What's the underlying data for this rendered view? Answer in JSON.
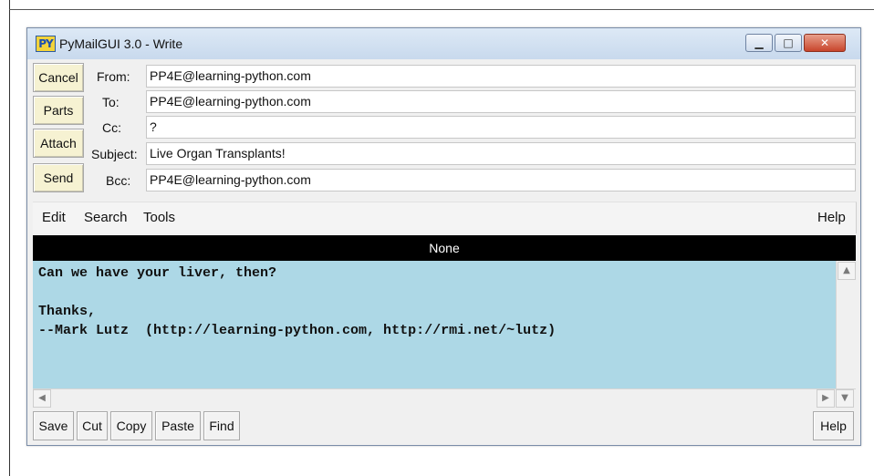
{
  "window": {
    "title": "PyMailGUI 3.0 - Write",
    "logo_text": "PY",
    "controls": {
      "minimize": "▁",
      "maximize": "□",
      "close": "✕"
    }
  },
  "side_buttons": [
    "Cancel",
    "Parts",
    "Attach",
    "Send"
  ],
  "headers": {
    "from": {
      "label": "From:",
      "value": "PP4E@learning-python.com"
    },
    "to": {
      "label": "To:",
      "value": "PP4E@learning-python.com"
    },
    "cc": {
      "label": "Cc:",
      "value": "?"
    },
    "subject": {
      "label": "Subject:",
      "value": "Live Organ Transplants!"
    },
    "bcc": {
      "label": "Bcc:",
      "value": "PP4E@learning-python.com"
    }
  },
  "menu": {
    "edit": "Edit",
    "search": "Search",
    "tools": "Tools",
    "help": "Help"
  },
  "status_bar": {
    "text": "None"
  },
  "editor": {
    "lines": [
      "Can we have your liver, then?",
      "",
      "Thanks,",
      "--Mark Lutz  (http://learning-python.com, http://rmi.net/~lutz)"
    ],
    "background": "#add8e6"
  },
  "scrollbar": {
    "up": "▲",
    "left": "◀",
    "right": "▶",
    "down": "▼"
  },
  "toolbar": {
    "save": "Save",
    "cut": "Cut",
    "copy": "Copy",
    "paste": "Paste",
    "find": "Find",
    "help": "Help"
  },
  "colors": {
    "side_button_bg": "#f6f2d2",
    "status_bar_bg": "#000000",
    "status_bar_fg": "#ffffff"
  }
}
